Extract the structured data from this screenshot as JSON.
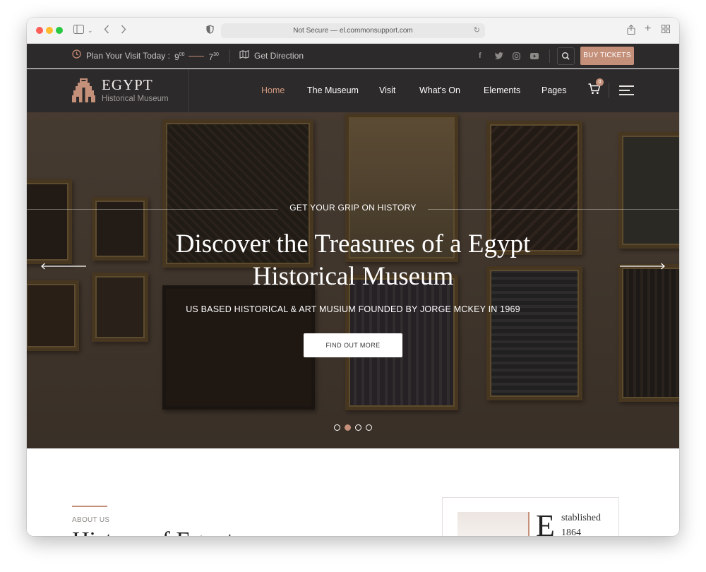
{
  "browser": {
    "url": "Not Secure — el.commonsupport.com"
  },
  "topbar": {
    "plan_label": "Plan Your Visit Today :",
    "open_hour": "9",
    "open_minutes": "00",
    "close_hour": "7",
    "close_minutes": "30",
    "direction_label": "Get Direction",
    "social": [
      "f",
      "t",
      "ig",
      "yt"
    ],
    "buy_tickets": "BUY TICKETS"
  },
  "brand": {
    "title": "EGYPT",
    "subtitle": "Historical Museum"
  },
  "nav": {
    "items": [
      "Home",
      "The Museum",
      "Visit",
      "What's On",
      "Elements",
      "Pages"
    ],
    "active_index": 0,
    "cart_count": "0"
  },
  "hero": {
    "tagline": "GET YOUR GRIP ON HISTORY",
    "title_line1": "Discover the Treasures of a Egypt",
    "title_line2": "Historical Museum",
    "subtitle": "US BASED HISTORICAL & ART MUSIUM FOUNDED BY JORGE MCKEY IN 1969",
    "button": "FIND OUT MORE",
    "slide_count": 4,
    "active_slide": 1
  },
  "about": {
    "label": "ABOUT US",
    "heading": "History of Egypt",
    "est_letter": "E",
    "est_line1": "stablished",
    "est_line2": "1864"
  },
  "colors": {
    "accent": "#c4907a",
    "dark": "#2c2a2b"
  }
}
